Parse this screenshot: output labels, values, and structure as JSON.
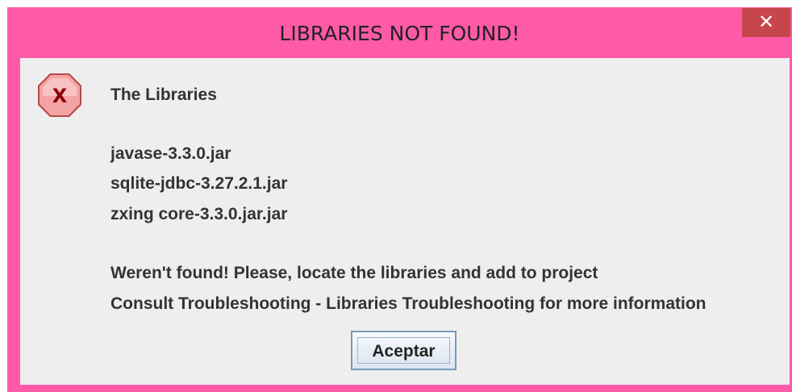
{
  "dialog": {
    "title": "LIBRARIES NOT FOUND!",
    "close_label": "✕",
    "icon": "error-x-icon",
    "icon_letter": "X",
    "header": "The Libraries",
    "libraries": [
      "javase-3.3.0.jar",
      "sqlite-jdbc-3.27.2.1.jar",
      "zxing core-3.3.0.jar.jar"
    ],
    "message_line_1": "Weren't found! Please, locate the libraries and add to project",
    "message_line_2": "Consult Troubleshooting - Libraries Troubleshooting for more information",
    "ok_label": "Aceptar"
  },
  "colors": {
    "titlebar": "#ff5aa8",
    "close_button": "#c7454c",
    "content_bg": "#eeeeee",
    "error_icon": "#f4a3a3"
  }
}
